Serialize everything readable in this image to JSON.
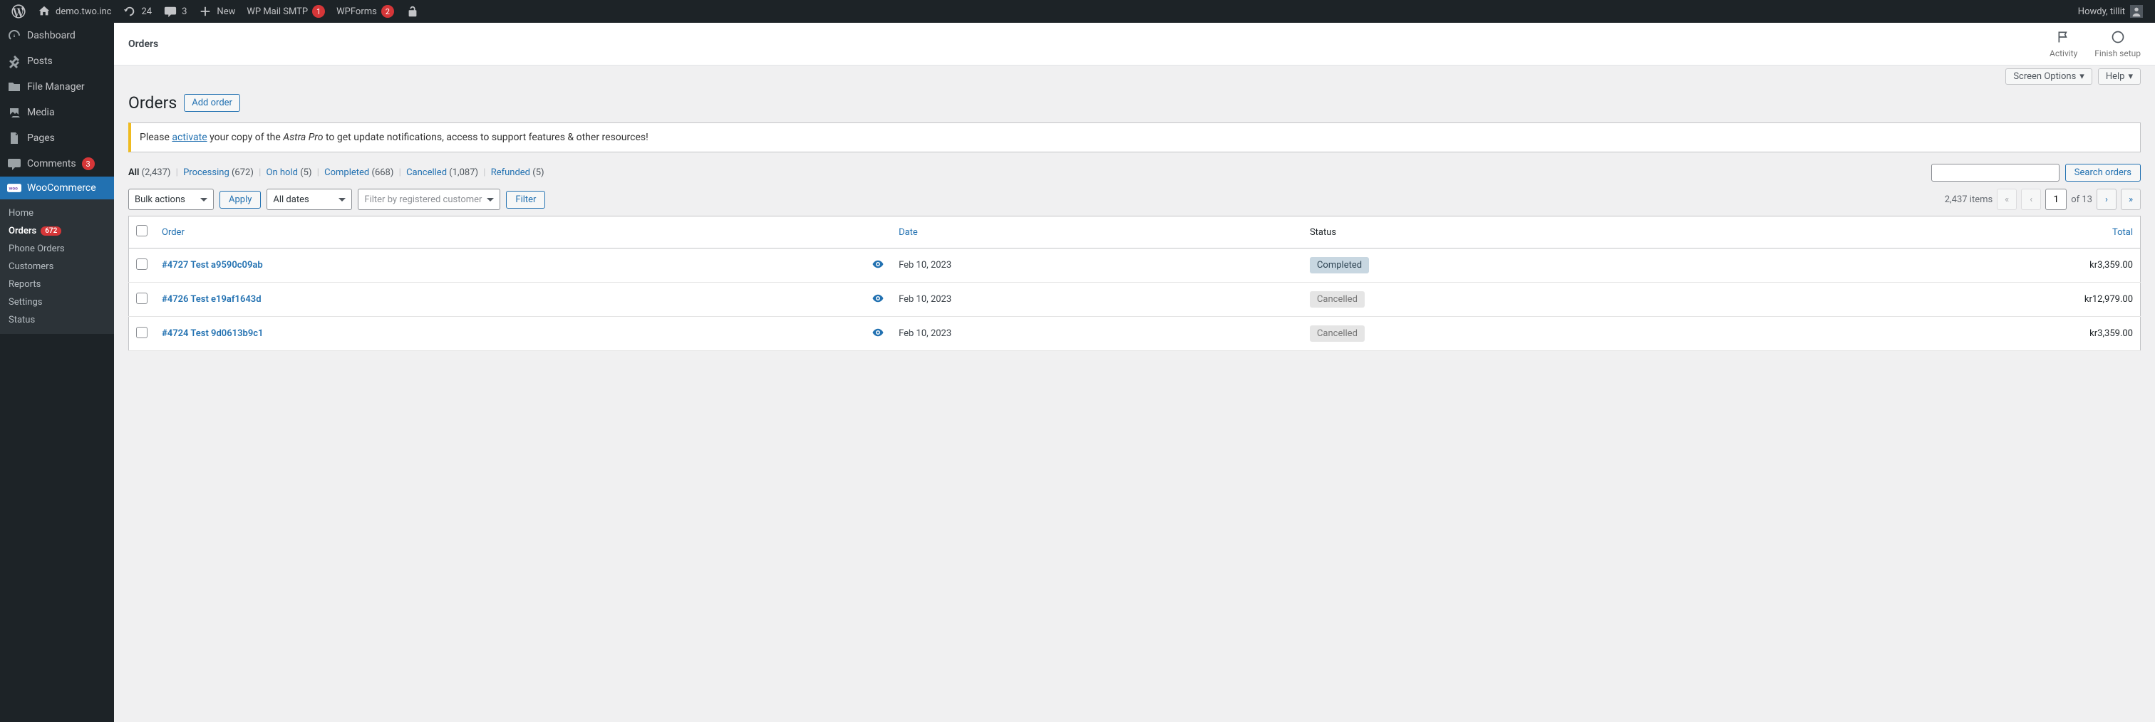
{
  "adminbar": {
    "site_name": "demo.two.inc",
    "updates_count": "24",
    "comments_count": "3",
    "new_label": "New",
    "wpmail_label": "WP Mail SMTP",
    "wpmail_badge": "1",
    "wpforms_label": "WPForms",
    "wpforms_badge": "2",
    "howdy": "Howdy, tillit"
  },
  "sidebar": {
    "items": [
      {
        "label": "Dashboard"
      },
      {
        "label": "Posts"
      },
      {
        "label": "File Manager"
      },
      {
        "label": "Media"
      },
      {
        "label": "Pages"
      },
      {
        "label": "Comments",
        "badge": "3"
      },
      {
        "label": "WooCommerce"
      }
    ],
    "submenu": [
      {
        "label": "Home"
      },
      {
        "label": "Orders",
        "badge": "672",
        "current": true
      },
      {
        "label": "Phone Orders"
      },
      {
        "label": "Customers"
      },
      {
        "label": "Reports"
      },
      {
        "label": "Settings"
      },
      {
        "label": "Status"
      }
    ]
  },
  "header": {
    "title_small": "Orders",
    "activity_label": "Activity",
    "finish_setup_label": "Finish setup"
  },
  "screen_options": {
    "screen_opts": "Screen Options",
    "help": "Help"
  },
  "title_row": {
    "title": "Orders",
    "add_order": "Add order"
  },
  "notice": {
    "pre": "Please ",
    "link": "activate",
    "post_a": " your copy of the ",
    "em": "Astra Pro",
    "post_b": " to get update notifications, access to support features & other resources!"
  },
  "views": {
    "all_label": "All",
    "all_count": "(2,437)",
    "processing": "Processing",
    "processing_count": "(672)",
    "onhold": "On hold",
    "onhold_count": "(5)",
    "completed": "Completed",
    "completed_count": "(668)",
    "cancelled": "Cancelled",
    "cancelled_count": "(1,087)",
    "refunded": "Refunded",
    "refunded_count": "(5)"
  },
  "search": {
    "button": "Search orders"
  },
  "tablenav": {
    "bulk_label": "Bulk actions",
    "apply": "Apply",
    "dates_label": "All dates",
    "customer_placeholder": "Filter by registered customer",
    "filter": "Filter",
    "items_count": "2,437 items",
    "page": "1",
    "total_pages_text": "of 13"
  },
  "table": {
    "cols": {
      "order": "Order",
      "date": "Date",
      "status": "Status",
      "total": "Total"
    },
    "rows": [
      {
        "order": "#4727 Test a9590c09ab",
        "date": "Feb 10, 2023",
        "status_label": "Completed",
        "status_class": "completed",
        "total": "kr3,359.00"
      },
      {
        "order": "#4726 Test e19af1643d",
        "date": "Feb 10, 2023",
        "status_label": "Cancelled",
        "status_class": "cancelled",
        "total": "kr12,979.00"
      },
      {
        "order": "#4724 Test 9d0613b9c1",
        "date": "Feb 10, 2023",
        "status_label": "Cancelled",
        "status_class": "cancelled",
        "total": "kr3,359.00"
      }
    ]
  }
}
